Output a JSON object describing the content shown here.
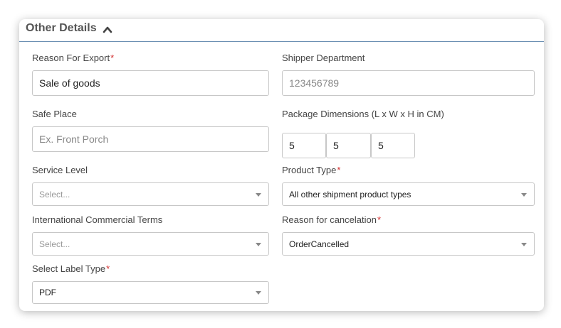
{
  "section": {
    "title": "Other Details",
    "toggle_icon": "chevron-up-icon"
  },
  "required_marker": "*",
  "fields": {
    "reason_for_export": {
      "label": "Reason For Export",
      "value": "Sale of goods"
    },
    "shipper_department": {
      "label": "Shipper Department",
      "placeholder": "123456789"
    },
    "safe_place": {
      "label": "Safe Place",
      "placeholder": "Ex. Front Porch"
    },
    "package_dimensions": {
      "label": "Package Dimensions (L x W x H in CM)",
      "length": "5",
      "width": "5",
      "height": "5"
    },
    "service_level": {
      "label": "Service Level",
      "placeholder": "Select..."
    },
    "product_type": {
      "label": "Product Type",
      "value": "All other shipment product types"
    },
    "incoterms": {
      "label": "International Commercial Terms",
      "placeholder": "Select..."
    },
    "reason_for_cancelation": {
      "label": "Reason for cancelation",
      "value": "OrderCancelled"
    },
    "label_type": {
      "label": "Select Label Type",
      "value": "PDF"
    }
  },
  "colors": {
    "required": "#d32f2f",
    "header_rule": "#6b8fb3",
    "border": "#c7c7c7"
  }
}
